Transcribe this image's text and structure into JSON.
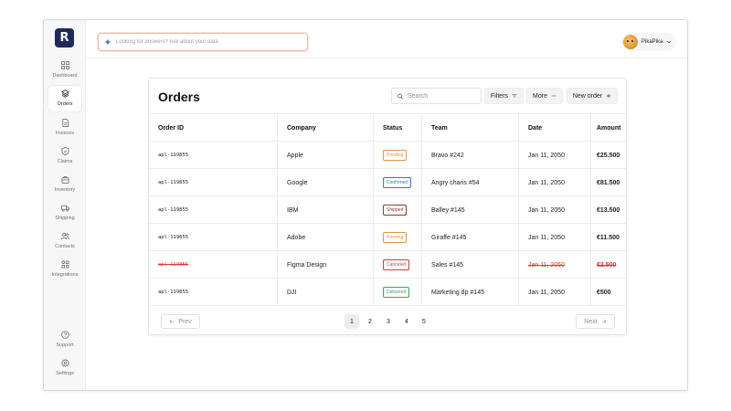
{
  "app": {
    "logo_letter": "R",
    "accent_color": "#1f2a5a"
  },
  "sidebar": {
    "items": [
      {
        "label": "Dashboard",
        "icon": "dashboard-icon",
        "active": false
      },
      {
        "label": "Orders",
        "icon": "box-icon",
        "active": true
      },
      {
        "label": "Invoices",
        "icon": "invoice-icon",
        "active": false
      },
      {
        "label": "Claims",
        "icon": "shield-icon",
        "active": false
      },
      {
        "label": "Inventory",
        "icon": "package-icon",
        "active": false
      },
      {
        "label": "Shipping",
        "icon": "truck-icon",
        "active": false
      },
      {
        "label": "Contacts",
        "icon": "users-icon",
        "active": false
      },
      {
        "label": "Integrations",
        "icon": "integrations-icon",
        "active": false
      }
    ],
    "bottom_items": [
      {
        "label": "Support",
        "icon": "help-icon"
      },
      {
        "label": "Settings",
        "icon": "gear-icon"
      }
    ]
  },
  "topbar": {
    "ai_search_placeholder": "Looking for answers? Ask about your data",
    "user_name": "PikaPika"
  },
  "orders": {
    "title": "Orders",
    "search_placeholder": "Search",
    "filters_label": "Filters",
    "more_label": "More",
    "new_order_label": "New order",
    "columns": [
      "Order ID",
      "Company",
      "Status",
      "Team",
      "Date",
      "Amount"
    ],
    "rows": [
      {
        "order_id": "apl-119855",
        "company": "Apple",
        "status": "Pending",
        "team": "Bravo #242",
        "date": "Jan 11, 2050",
        "amount": "€25.500",
        "canceled": false
      },
      {
        "order_id": "apl-119855",
        "company": "Google",
        "status": "Confirmed",
        "team": "Angry charis #54",
        "date": "Jan 11, 2050",
        "amount": "€81.500",
        "canceled": false
      },
      {
        "order_id": "apl-119855",
        "company": "IBM",
        "status": "Shipped",
        "team": "Balley #145",
        "date": "Jan 11, 2050",
        "amount": "€13.500",
        "canceled": false
      },
      {
        "order_id": "apl-119855",
        "company": "Adobe",
        "status": "Pending",
        "team": "Giraffe #145",
        "date": "Jan 11, 2050",
        "amount": "€11.500",
        "canceled": false
      },
      {
        "order_id": "apl-119855",
        "company": "Figma Design",
        "status": "Canceled",
        "team": "Sales #145",
        "date": "Jan 11, 2050",
        "amount": "€2.500",
        "canceled": true
      },
      {
        "order_id": "apl-119855",
        "company": "DJI",
        "status": "Delivered",
        "team": "Marketing dp #145",
        "date": "Jan 11, 2050",
        "amount": "€500",
        "canceled": false
      }
    ],
    "status_colors": {
      "Pending": "#e0954a",
      "Confirmed": "#3b6fd9",
      "Shipped": "#8a3b2c",
      "Canceled": "#d93a3a",
      "Delivered": "#3aa65a"
    },
    "pagination": {
      "prev_label": "Prev",
      "next_label": "Next",
      "pages": [
        "1",
        "2",
        "3",
        "4",
        "5"
      ],
      "current": "1"
    }
  }
}
